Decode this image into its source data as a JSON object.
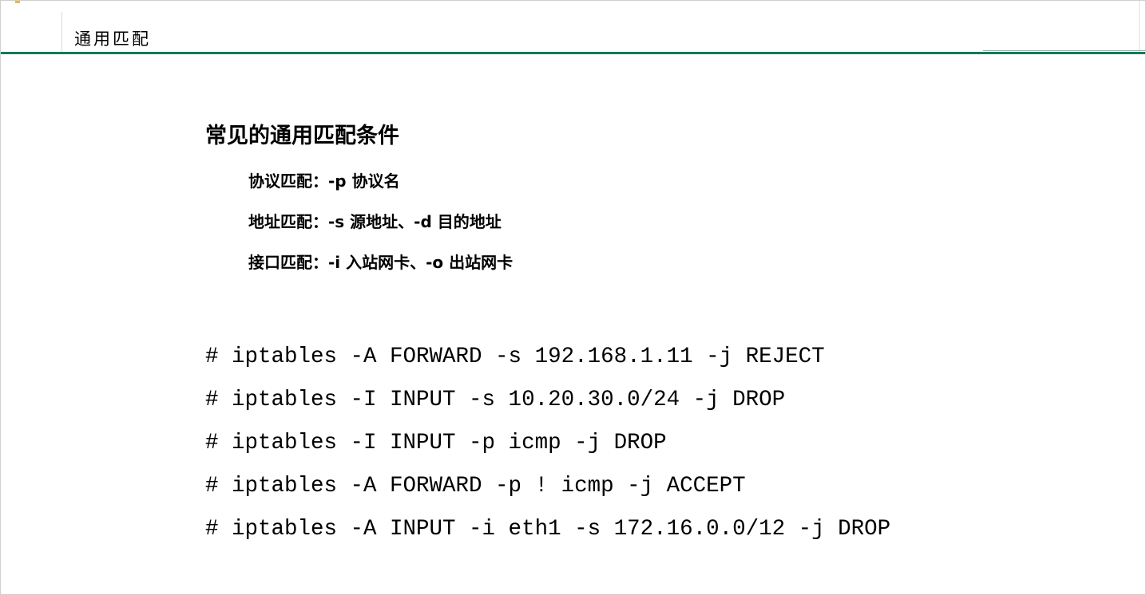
{
  "header": {
    "title": "通用匹配"
  },
  "content": {
    "heading": "常见的通用匹配条件",
    "conditions": [
      "协议匹配：-p 协议名",
      "地址匹配：-s 源地址、-d 目的地址",
      "接口匹配：-i 入站网卡、-o 出站网卡"
    ],
    "commands": [
      "# iptables -A FORWARD -s 192.168.1.11 -j REJECT",
      "# iptables -I INPUT -s 10.20.30.0/24 -j DROP",
      "# iptables -I INPUT -p icmp -j DROP",
      "# iptables -A FORWARD -p ! icmp -j ACCEPT",
      "# iptables -A INPUT -i eth1 -s 172.16.0.0/12 -j DROP"
    ]
  },
  "colors": {
    "accent_rule": "#0f7a5c",
    "corner_mark": "#e8b84a",
    "text": "#000000",
    "background": "#ffffff"
  }
}
